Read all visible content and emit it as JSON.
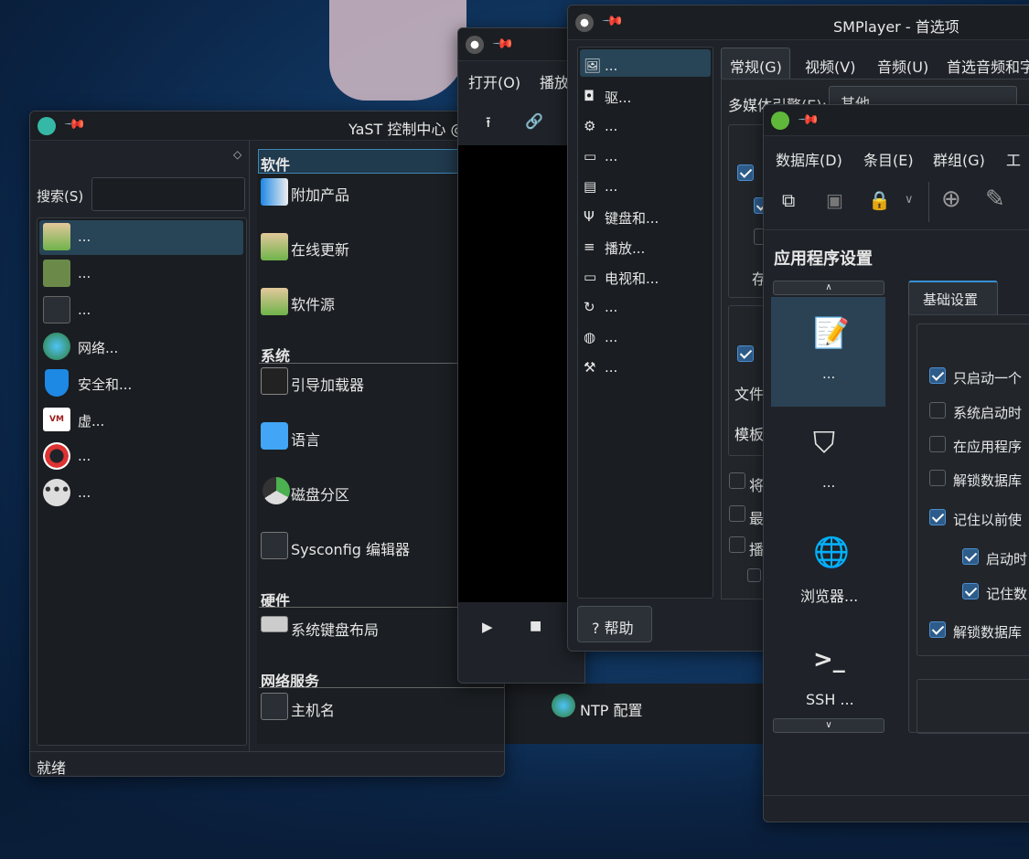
{
  "yast": {
    "title": "YaST 控制中心 @",
    "search_label": "搜索(S)",
    "search_value": "",
    "status": "就绪",
    "categories": [
      "...",
      "...",
      "...",
      "网络...",
      "安全和...",
      "虚...",
      "...",
      "..."
    ],
    "sections": {
      "software": "软件",
      "system": "系统",
      "hardware": "硬件",
      "network": "网络服务"
    },
    "modules": {
      "addon": "附加产品",
      "online_update": "在线更新",
      "repos": "软件源",
      "bootloader": "引导加载器",
      "language": "语言",
      "partitioner": "磁盘分区",
      "sysconfig": "Sysconfig 编辑器",
      "keyboard": "系统键盘布局",
      "hostname": "主机名",
      "ntp": "NTP 配置"
    }
  },
  "smplayer_main": {
    "menu_open": "打开(O)",
    "menu_play": "播放"
  },
  "smplayer_pref": {
    "title": "SMPlayer - 首选项",
    "sections": [
      "...",
      "驱...",
      "...",
      "...",
      "...",
      "键盘和...",
      "播放...",
      "电视和...",
      "...",
      "...",
      "..."
    ],
    "tabs": [
      "常规(G)",
      "视频(V)",
      "音频(U)",
      "首选音频和字"
    ],
    "engine_label": "多媒体引擎(E):",
    "engine_value": "其他",
    "help_button": "? 帮助",
    "partial_labels": [
      "文件",
      "模板",
      "将",
      "最",
      "播"
    ]
  },
  "keepass": {
    "menus": [
      "数据库(D)",
      "条目(E)",
      "群组(G)",
      "工"
    ],
    "heading": "应用程序设置",
    "nav": [
      "...",
      "...",
      "浏览器...",
      "SSH ..."
    ],
    "tab": "基础设置",
    "options": [
      "只启动一个",
      "系统启动时",
      "在应用程序",
      "解锁数据库",
      "记住以前使",
      "启动时",
      "记住数",
      "解锁数据库"
    ],
    "options_checked": [
      true,
      false,
      false,
      false,
      true,
      true,
      true,
      true
    ]
  }
}
